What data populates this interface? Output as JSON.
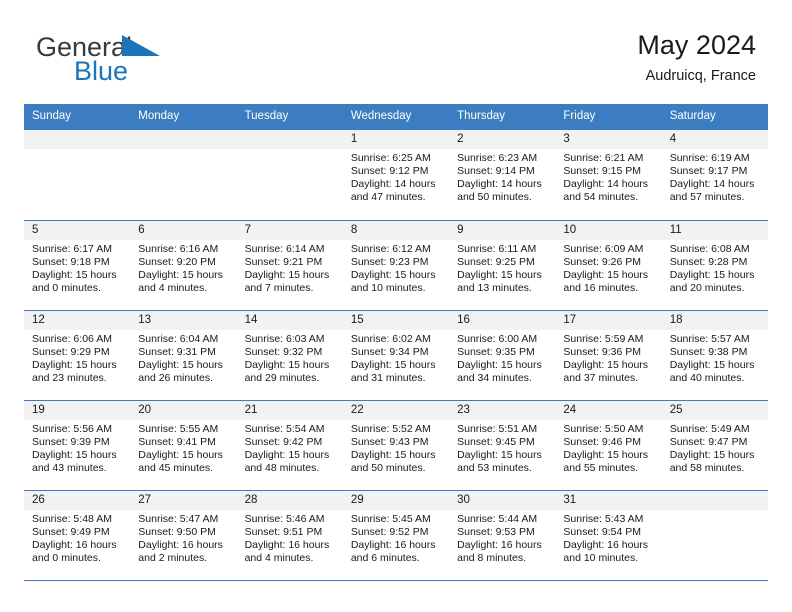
{
  "brand": {
    "name_part1": "General",
    "name_part2": "Blue",
    "triangle_icon": "triangle-icon",
    "accent_color": "#1b75bb"
  },
  "header": {
    "title": "May 2024",
    "subtitle": "Audruicq, France"
  },
  "theme": {
    "header_blue": "#3b7dc0",
    "day_band_gray": "#f2f2f2",
    "text": "#1a1a1a"
  },
  "weekdays": [
    "Sunday",
    "Monday",
    "Tuesday",
    "Wednesday",
    "Thursday",
    "Friday",
    "Saturday"
  ],
  "weeks": [
    [
      {
        "day": "",
        "empty": true
      },
      {
        "day": "",
        "empty": true
      },
      {
        "day": "",
        "empty": true
      },
      {
        "day": "1",
        "sunrise": "Sunrise: 6:25 AM",
        "sunset": "Sunset: 9:12 PM",
        "daylight_line1": "Daylight: 14 hours",
        "daylight_line2": "and 47 minutes."
      },
      {
        "day": "2",
        "sunrise": "Sunrise: 6:23 AM",
        "sunset": "Sunset: 9:14 PM",
        "daylight_line1": "Daylight: 14 hours",
        "daylight_line2": "and 50 minutes."
      },
      {
        "day": "3",
        "sunrise": "Sunrise: 6:21 AM",
        "sunset": "Sunset: 9:15 PM",
        "daylight_line1": "Daylight: 14 hours",
        "daylight_line2": "and 54 minutes."
      },
      {
        "day": "4",
        "sunrise": "Sunrise: 6:19 AM",
        "sunset": "Sunset: 9:17 PM",
        "daylight_line1": "Daylight: 14 hours",
        "daylight_line2": "and 57 minutes."
      }
    ],
    [
      {
        "day": "5",
        "sunrise": "Sunrise: 6:17 AM",
        "sunset": "Sunset: 9:18 PM",
        "daylight_line1": "Daylight: 15 hours",
        "daylight_line2": "and 0 minutes."
      },
      {
        "day": "6",
        "sunrise": "Sunrise: 6:16 AM",
        "sunset": "Sunset: 9:20 PM",
        "daylight_line1": "Daylight: 15 hours",
        "daylight_line2": "and 4 minutes."
      },
      {
        "day": "7",
        "sunrise": "Sunrise: 6:14 AM",
        "sunset": "Sunset: 9:21 PM",
        "daylight_line1": "Daylight: 15 hours",
        "daylight_line2": "and 7 minutes."
      },
      {
        "day": "8",
        "sunrise": "Sunrise: 6:12 AM",
        "sunset": "Sunset: 9:23 PM",
        "daylight_line1": "Daylight: 15 hours",
        "daylight_line2": "and 10 minutes."
      },
      {
        "day": "9",
        "sunrise": "Sunrise: 6:11 AM",
        "sunset": "Sunset: 9:25 PM",
        "daylight_line1": "Daylight: 15 hours",
        "daylight_line2": "and 13 minutes."
      },
      {
        "day": "10",
        "sunrise": "Sunrise: 6:09 AM",
        "sunset": "Sunset: 9:26 PM",
        "daylight_line1": "Daylight: 15 hours",
        "daylight_line2": "and 16 minutes."
      },
      {
        "day": "11",
        "sunrise": "Sunrise: 6:08 AM",
        "sunset": "Sunset: 9:28 PM",
        "daylight_line1": "Daylight: 15 hours",
        "daylight_line2": "and 20 minutes."
      }
    ],
    [
      {
        "day": "12",
        "sunrise": "Sunrise: 6:06 AM",
        "sunset": "Sunset: 9:29 PM",
        "daylight_line1": "Daylight: 15 hours",
        "daylight_line2": "and 23 minutes."
      },
      {
        "day": "13",
        "sunrise": "Sunrise: 6:04 AM",
        "sunset": "Sunset: 9:31 PM",
        "daylight_line1": "Daylight: 15 hours",
        "daylight_line2": "and 26 minutes."
      },
      {
        "day": "14",
        "sunrise": "Sunrise: 6:03 AM",
        "sunset": "Sunset: 9:32 PM",
        "daylight_line1": "Daylight: 15 hours",
        "daylight_line2": "and 29 minutes."
      },
      {
        "day": "15",
        "sunrise": "Sunrise: 6:02 AM",
        "sunset": "Sunset: 9:34 PM",
        "daylight_line1": "Daylight: 15 hours",
        "daylight_line2": "and 31 minutes."
      },
      {
        "day": "16",
        "sunrise": "Sunrise: 6:00 AM",
        "sunset": "Sunset: 9:35 PM",
        "daylight_line1": "Daylight: 15 hours",
        "daylight_line2": "and 34 minutes."
      },
      {
        "day": "17",
        "sunrise": "Sunrise: 5:59 AM",
        "sunset": "Sunset: 9:36 PM",
        "daylight_line1": "Daylight: 15 hours",
        "daylight_line2": "and 37 minutes."
      },
      {
        "day": "18",
        "sunrise": "Sunrise: 5:57 AM",
        "sunset": "Sunset: 9:38 PM",
        "daylight_line1": "Daylight: 15 hours",
        "daylight_line2": "and 40 minutes."
      }
    ],
    [
      {
        "day": "19",
        "sunrise": "Sunrise: 5:56 AM",
        "sunset": "Sunset: 9:39 PM",
        "daylight_line1": "Daylight: 15 hours",
        "daylight_line2": "and 43 minutes."
      },
      {
        "day": "20",
        "sunrise": "Sunrise: 5:55 AM",
        "sunset": "Sunset: 9:41 PM",
        "daylight_line1": "Daylight: 15 hours",
        "daylight_line2": "and 45 minutes."
      },
      {
        "day": "21",
        "sunrise": "Sunrise: 5:54 AM",
        "sunset": "Sunset: 9:42 PM",
        "daylight_line1": "Daylight: 15 hours",
        "daylight_line2": "and 48 minutes."
      },
      {
        "day": "22",
        "sunrise": "Sunrise: 5:52 AM",
        "sunset": "Sunset: 9:43 PM",
        "daylight_line1": "Daylight: 15 hours",
        "daylight_line2": "and 50 minutes."
      },
      {
        "day": "23",
        "sunrise": "Sunrise: 5:51 AM",
        "sunset": "Sunset: 9:45 PM",
        "daylight_line1": "Daylight: 15 hours",
        "daylight_line2": "and 53 minutes."
      },
      {
        "day": "24",
        "sunrise": "Sunrise: 5:50 AM",
        "sunset": "Sunset: 9:46 PM",
        "daylight_line1": "Daylight: 15 hours",
        "daylight_line2": "and 55 minutes."
      },
      {
        "day": "25",
        "sunrise": "Sunrise: 5:49 AM",
        "sunset": "Sunset: 9:47 PM",
        "daylight_line1": "Daylight: 15 hours",
        "daylight_line2": "and 58 minutes."
      }
    ],
    [
      {
        "day": "26",
        "sunrise": "Sunrise: 5:48 AM",
        "sunset": "Sunset: 9:49 PM",
        "daylight_line1": "Daylight: 16 hours",
        "daylight_line2": "and 0 minutes."
      },
      {
        "day": "27",
        "sunrise": "Sunrise: 5:47 AM",
        "sunset": "Sunset: 9:50 PM",
        "daylight_line1": "Daylight: 16 hours",
        "daylight_line2": "and 2 minutes."
      },
      {
        "day": "28",
        "sunrise": "Sunrise: 5:46 AM",
        "sunset": "Sunset: 9:51 PM",
        "daylight_line1": "Daylight: 16 hours",
        "daylight_line2": "and 4 minutes."
      },
      {
        "day": "29",
        "sunrise": "Sunrise: 5:45 AM",
        "sunset": "Sunset: 9:52 PM",
        "daylight_line1": "Daylight: 16 hours",
        "daylight_line2": "and 6 minutes."
      },
      {
        "day": "30",
        "sunrise": "Sunrise: 5:44 AM",
        "sunset": "Sunset: 9:53 PM",
        "daylight_line1": "Daylight: 16 hours",
        "daylight_line2": "and 8 minutes."
      },
      {
        "day": "31",
        "sunrise": "Sunrise: 5:43 AM",
        "sunset": "Sunset: 9:54 PM",
        "daylight_line1": "Daylight: 16 hours",
        "daylight_line2": "and 10 minutes."
      },
      {
        "day": "",
        "empty": true
      }
    ]
  ]
}
